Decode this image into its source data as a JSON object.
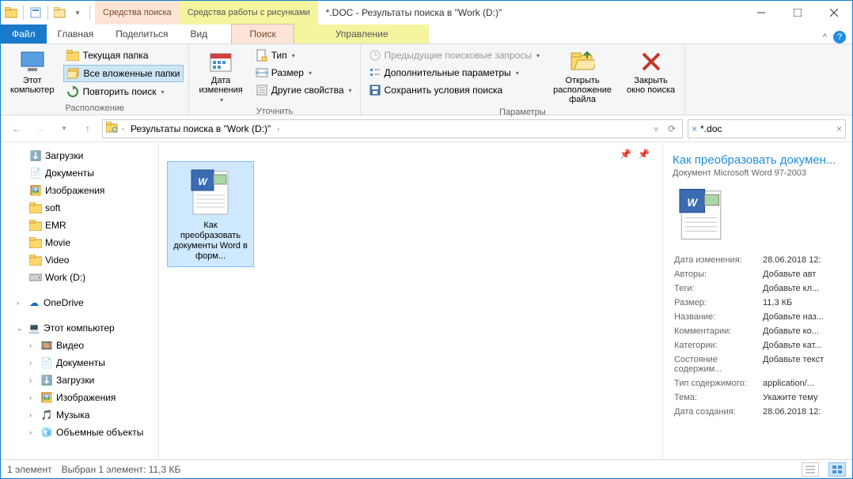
{
  "titlebar": {
    "ctx_search": "Средства поиска",
    "ctx_picture": "Средства работы с рисунками",
    "title": "*.DOC - Результаты поиска в \"Work (D:)\""
  },
  "tabs": {
    "file": "Файл",
    "home": "Главная",
    "share": "Поделиться",
    "view": "Вид",
    "search": "Поиск",
    "manage": "Управление"
  },
  "ribbon": {
    "this_computer": "Этот\nкомпьютер",
    "current_folder": "Текущая папка",
    "all_subfolders": "Все вложенные папки",
    "repeat_search": "Повторить поиск ",
    "grp_location": "Расположение",
    "date_modified": "Дата\nизменения",
    "type": "Тип ",
    "size": "Размер ",
    "other_props": "Другие свойства ",
    "grp_refine": "Уточнить",
    "prev_queries": "Предыдущие поисковые запросы ",
    "adv_params": "Дополнительные параметры ",
    "save_search": "Сохранить условия поиска",
    "open_location": "Открыть\nрасположение файла",
    "close_search": "Закрыть\nокно поиска",
    "grp_params": "Параметры"
  },
  "address": {
    "crumb1": "Результаты поиска в \"Work (D:)\"",
    "search_value": "*.doc"
  },
  "nav": {
    "downloads": "Загрузки",
    "documents": "Документы",
    "pictures": "Изображения",
    "soft": "soft",
    "emr": "EMR",
    "movie": "Movie",
    "video": "Video",
    "work": "Work (D:)",
    "onedrive": "OneDrive",
    "this_pc": "Этот компьютер",
    "videos": "Видео",
    "documents2": "Документы",
    "downloads2": "Загрузки",
    "pictures2": "Изображения",
    "music": "Музыка",
    "objects3d": "Объемные объекты"
  },
  "file": {
    "name": "Как преобразовать документы Word в форм..."
  },
  "details": {
    "title": "Как преобразовать докумен...",
    "subtitle": "Документ Microsoft Word 97-2003",
    "rows": [
      {
        "k": "Дата изменения:",
        "v": "28.06.2018 12:"
      },
      {
        "k": "Авторы:",
        "v": "Добавьте авт"
      },
      {
        "k": "Теги:",
        "v": "Добавьте кл..."
      },
      {
        "k": "Размер:",
        "v": "11,3 КБ"
      },
      {
        "k": "Название:",
        "v": "Добавьте наз..."
      },
      {
        "k": "Комментарии:",
        "v": "Добавьте ко..."
      },
      {
        "k": "Категории:",
        "v": "Добавьте кат..."
      },
      {
        "k": "Состояние содержим...",
        "v": "Добавьте текст"
      },
      {
        "k": "Тип содержимого:",
        "v": "application/..."
      },
      {
        "k": "Тема:",
        "v": "Укажите тему"
      },
      {
        "k": "Дата создания:",
        "v": "28.06.2018 12:"
      }
    ]
  },
  "status": {
    "count": "1 элемент",
    "selected": "Выбран 1 элемент: 11,3 КБ"
  }
}
